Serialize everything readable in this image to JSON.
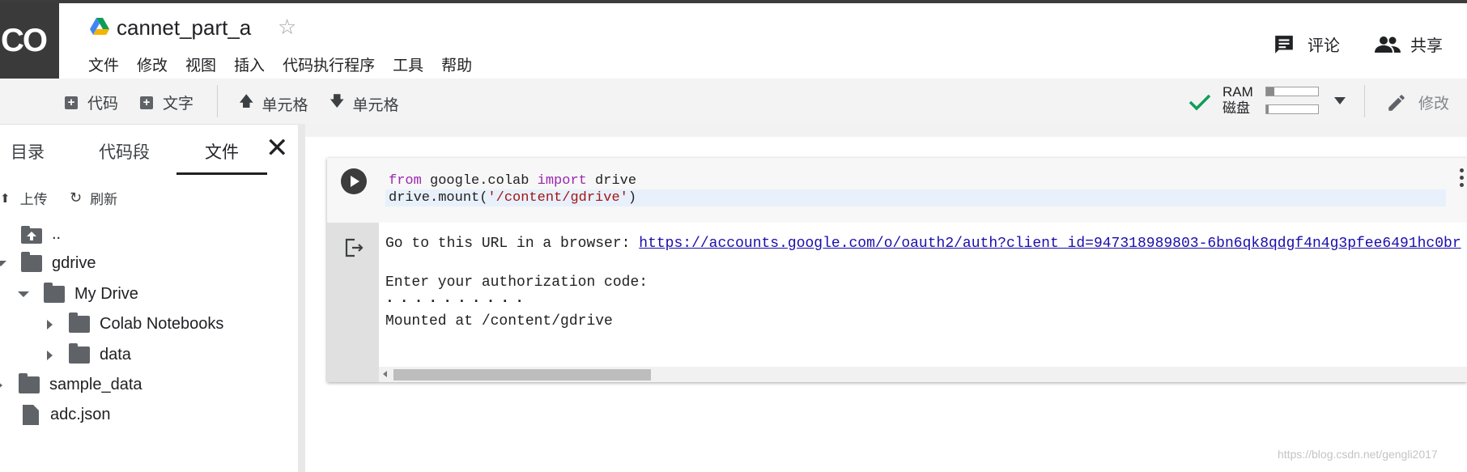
{
  "logo": "CO",
  "header": {
    "title": "cannet_part_a",
    "menu": [
      "文件",
      "修改",
      "视图",
      "插入",
      "代码执行程序",
      "工具",
      "帮助"
    ],
    "comment_label": "评论",
    "share_label": "共享"
  },
  "toolbar": {
    "add_code": "代码",
    "add_text": "文字",
    "cell_up": "单元格",
    "cell_down": "单元格",
    "ram_label": "RAM",
    "disk_label": "磁盘",
    "ram_usage": 0.15,
    "disk_usage": 0.05,
    "edit_label": "修改"
  },
  "sidebar": {
    "tabs": [
      "目录",
      "代码段",
      "文件"
    ],
    "active_tab": "文件",
    "upload_label": "上传",
    "refresh_label": "刷新",
    "tree": [
      {
        "name": "..",
        "type": "parent"
      },
      {
        "name": "gdrive",
        "type": "folder"
      },
      {
        "name": "My Drive",
        "type": "folder"
      },
      {
        "name": "Colab Notebooks",
        "type": "folder"
      },
      {
        "name": "data",
        "type": "folder"
      },
      {
        "name": "sample_data",
        "type": "folder"
      },
      {
        "name": "adc.json",
        "type": "file"
      }
    ]
  },
  "cell": {
    "code_line1_kw1": "from",
    "code_line1_mid": " google.colab ",
    "code_line1_kw2": "import",
    "code_line1_end": " drive",
    "code_line2_pre": "drive.mount(",
    "code_line2_str": "'/content/gdrive'",
    "code_line2_post": ")",
    "output_prefix": "Go to this URL in a browser: ",
    "output_url": "https://accounts.google.com/o/oauth2/auth?client_id=947318989803-6bn6qk8qdgf4n4g3pfee6491hc0br",
    "output_prompt": "Enter your authorization code:",
    "output_masked": "··········",
    "output_mounted": "Mounted at /content/gdrive"
  },
  "watermark": "https://blog.csdn.net/gengli2017",
  "colors": {
    "accent_green": "#0f9d58",
    "link": "#1a0dab"
  }
}
